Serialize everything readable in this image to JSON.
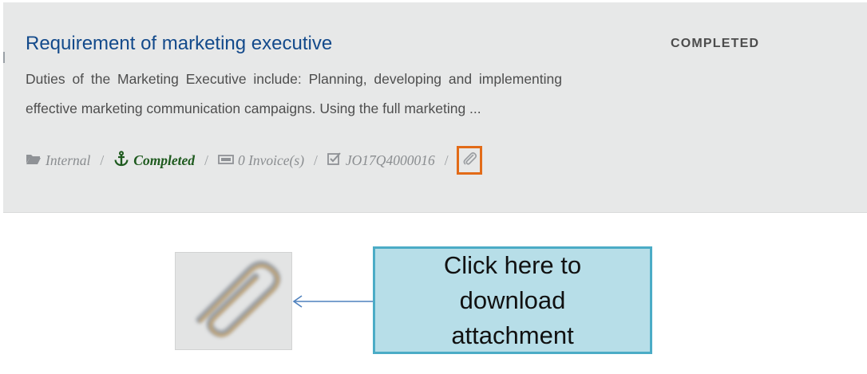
{
  "card": {
    "title": "Requirement of marketing executive",
    "status": "COMPLETED",
    "description": "Duties of the Marketing Executive include: Planning, developing and implementing effective marketing communication campaigns. Using the full marketing ...",
    "meta": {
      "type_icon": "folder-icon",
      "type": "Internal",
      "status_icon": "anchor-icon",
      "status": "Completed",
      "invoices_icon": "money-icon",
      "invoices": "0 Invoice(s)",
      "job_icon": "check-square-icon",
      "job_id": "JO17Q4000016",
      "separator": "/",
      "attachment_icon": "paperclip-icon"
    }
  },
  "annotation": {
    "zoom_icon": "paperclip-icon",
    "callout_lines": [
      "Click here to",
      "download",
      "attachment"
    ],
    "highlight_color": "#e26b18",
    "callout_fill": "#b7dee8",
    "callout_border": "#4bacc6",
    "arrow_color": "#4f81bd"
  },
  "colors": {
    "card_background": "#e7e8e8",
    "title": "#134a8b",
    "completed_green": "#1e5a1e"
  }
}
